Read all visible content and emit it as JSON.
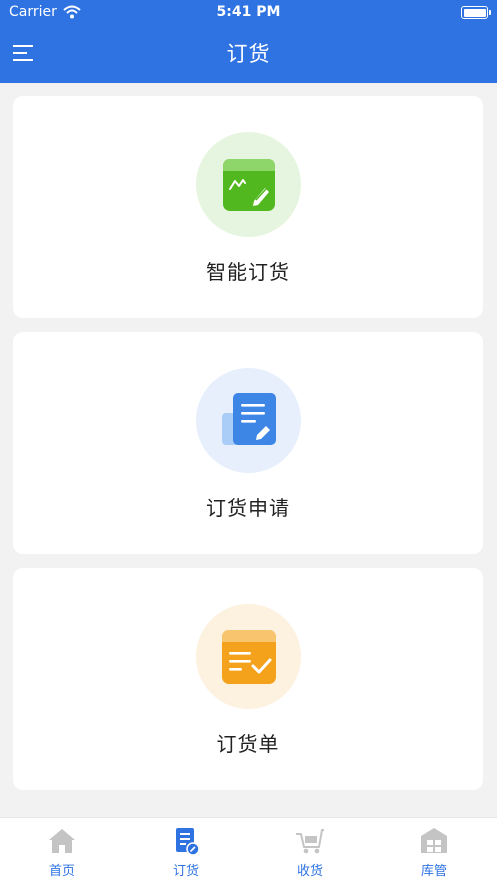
{
  "status_bar": {
    "carrier": "Carrier",
    "time": "5:41 PM"
  },
  "header": {
    "title": "订货"
  },
  "cards": [
    {
      "label": "智能订货",
      "icon": "chart-pen-icon",
      "color": "#52b81f",
      "bg": "#e6f5df"
    },
    {
      "label": "订货申请",
      "icon": "document-pen-icon",
      "color": "#3d86e6",
      "bg": "#e6effb"
    },
    {
      "label": "订货单",
      "icon": "list-check-icon",
      "color": "#f4a11c",
      "bg": "#fdf1e0"
    }
  ],
  "tabbar": {
    "tabs": [
      {
        "label": "首页",
        "icon": "home-icon"
      },
      {
        "label": "订货",
        "icon": "order-icon",
        "active": true
      },
      {
        "label": "收货",
        "icon": "cart-icon"
      },
      {
        "label": "库管",
        "icon": "warehouse-icon"
      }
    ]
  },
  "colors": {
    "primary": "#2f73e3",
    "background": "#f2f2f2",
    "inactive_icon": "#c4c4c4"
  }
}
